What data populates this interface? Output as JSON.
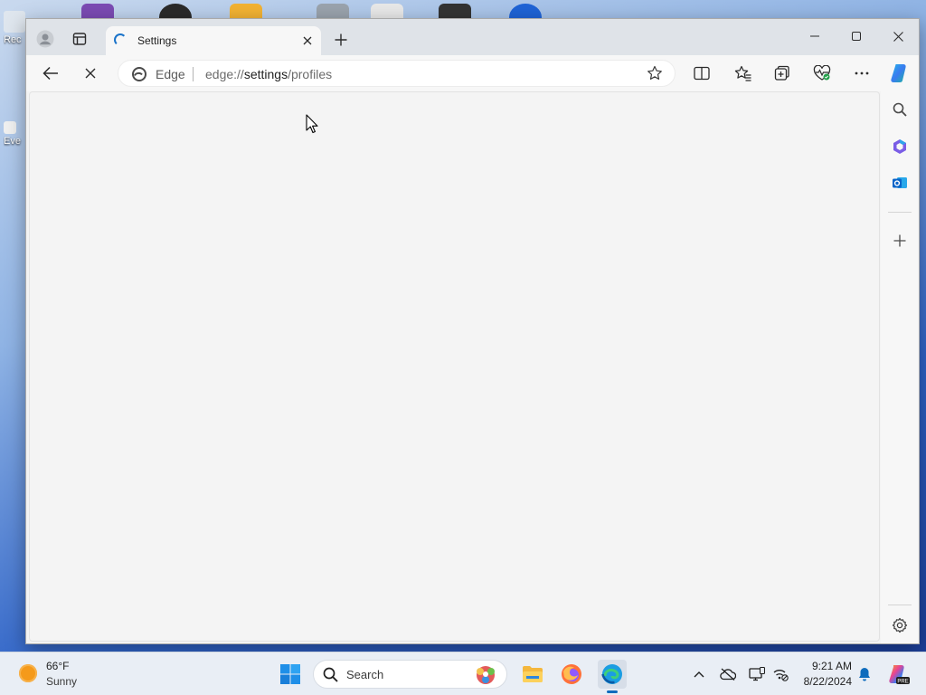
{
  "desktop": {
    "icons": [
      {
        "label": "Rec",
        "name": "recycle-bin-icon"
      },
      {
        "label": "Eve",
        "name": "shortcut-icon"
      }
    ]
  },
  "browser": {
    "tab": {
      "title": "Settings"
    },
    "address": {
      "site_label": "Edge",
      "url_prefix": "edge://",
      "url_host": "settings",
      "url_path": "/profiles"
    }
  },
  "taskbar": {
    "weather": {
      "temp": "66°F",
      "condition": "Sunny"
    },
    "search": {
      "placeholder": "Search"
    },
    "clock": {
      "time": "9:21 AM",
      "date": "8/22/2024"
    },
    "copilot_badge": "PRE"
  },
  "colors": {
    "accent": "#0f6cbd",
    "weather_sun": "#f59a1b",
    "copilot_blue": "#1a73c9"
  }
}
